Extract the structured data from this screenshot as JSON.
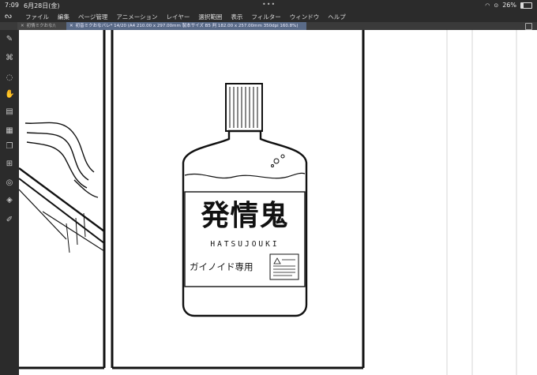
{
  "status_bar": {
    "time": "7:09",
    "date": "6月28日(金)",
    "battery": "26%"
  },
  "menu": {
    "items": [
      "ファイル",
      "編集",
      "ページ管理",
      "アニメーション",
      "レイヤー",
      "選択範囲",
      "表示",
      "フィルター",
      "ウィンドウ",
      "ヘルプ"
    ]
  },
  "tabs": [
    {
      "label": "初情ミクおな/\\"
    },
    {
      "label": "初音ミクおなバレ* 14/20 (A4 210.00 x 297.00mm 製本サイズ B5 判 182.00 x 257.00mm 350dpi 160.8%)"
    }
  ],
  "toolbar": {
    "icons": [
      "pen-icon",
      "brush-icon",
      "lasso-icon",
      "hand-icon",
      "layer-icon",
      "panel-icon",
      "copy-icon",
      "camera-icon",
      "material-icon",
      "navigator-icon",
      "stack-icon",
      "eyedropper-icon"
    ]
  },
  "artwork": {
    "brand_kanji": "発情鬼",
    "brand_romaji": "HATSUJOUKI",
    "sub_label": "ガイノイド専用"
  },
  "colors": {
    "accent_tab": "#5a6b88",
    "background": "#2b2b2b"
  }
}
